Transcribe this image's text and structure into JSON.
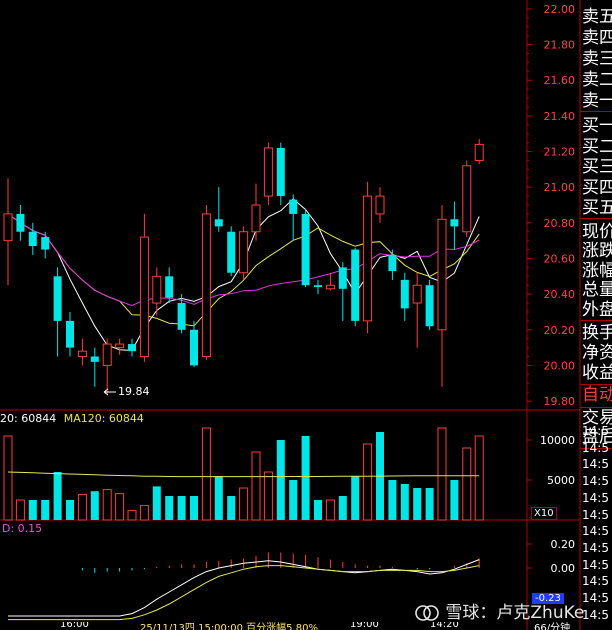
{
  "price_axis": {
    "ticks": [
      "22.00",
      "21.80",
      "21.60",
      "21.40",
      "21.20",
      "21.00",
      "20.80",
      "20.60",
      "20.40",
      "20.20",
      "20.00",
      "19.80"
    ],
    "low_marker": "19.84"
  },
  "side_labels": {
    "group1": [
      "卖五",
      "卖四",
      "卖三",
      "卖二",
      "卖一"
    ],
    "group2": [
      "买一",
      "买二",
      "买三",
      "买四",
      "买五"
    ],
    "group3": [
      "现价",
      "涨跌",
      "涨幅",
      "总量",
      "外盘"
    ],
    "group4": [
      "换手",
      "净资",
      "收益"
    ],
    "auto": "自动",
    "group5": [
      "交易",
      "盘后"
    ]
  },
  "volume_panel": {
    "legend_ma": "20: 60844",
    "legend_ma120": "MA120: 60844",
    "ticks": [
      "10000",
      "5000"
    ],
    "unit": "X10"
  },
  "macd_panel": {
    "legend": "D: 0.15",
    "ticks": [
      "0.20",
      "0.00"
    ],
    "current_value": "-0.23"
  },
  "time_column": [
    "14:5",
    "14:5",
    "14:5",
    "14:5",
    "14:5",
    "14:5",
    "14:5",
    "14:5",
    "14:5",
    "14:5",
    "14:5",
    "14:5"
  ],
  "bottom_status": [
    "16:00",
    "25/11/13四 15:00:00 百分涨幅5.80%",
    "19:00",
    "14:20",
    "66/分钟"
  ],
  "watermark": "雪球：卢克ZhuKe",
  "colors": {
    "up": "#ff3c3c",
    "down": "#00e5e5",
    "ma_white": "#ffffff",
    "ma_yellow": "#e6e64c",
    "ma_magenta": "#dd33dd",
    "grid_red": "#b00000"
  },
  "chart_data": {
    "type": "candlestick",
    "ylim": [
      19.75,
      22.05
    ],
    "candles": [
      {
        "o": 20.7,
        "c": 20.85,
        "h": 21.05,
        "l": 20.45
      },
      {
        "o": 20.85,
        "c": 20.75,
        "h": 20.9,
        "l": 20.7
      },
      {
        "o": 20.75,
        "c": 20.67,
        "h": 20.8,
        "l": 20.62
      },
      {
        "o": 20.72,
        "c": 20.65,
        "h": 20.75,
        "l": 20.6
      },
      {
        "o": 20.5,
        "c": 20.25,
        "h": 20.55,
        "l": 20.05
      },
      {
        "o": 20.25,
        "c": 20.1,
        "h": 20.3,
        "l": 20.05
      },
      {
        "o": 20.05,
        "c": 20.08,
        "h": 20.15,
        "l": 20.0
      },
      {
        "o": 20.05,
        "c": 20.02,
        "h": 20.1,
        "l": 19.88
      },
      {
        "o": 20.0,
        "c": 20.12,
        "h": 20.15,
        "l": 19.84
      },
      {
        "o": 20.1,
        "c": 20.12,
        "h": 20.15,
        "l": 20.06
      },
      {
        "o": 20.12,
        "c": 20.08,
        "h": 20.15,
        "l": 20.05
      },
      {
        "o": 20.05,
        "c": 20.72,
        "h": 20.85,
        "l": 20.02
      },
      {
        "o": 20.35,
        "c": 20.5,
        "h": 20.55,
        "l": 20.28
      },
      {
        "o": 20.5,
        "c": 20.38,
        "h": 20.55,
        "l": 20.35
      },
      {
        "o": 20.35,
        "c": 20.2,
        "h": 20.4,
        "l": 20.18
      },
      {
        "o": 20.2,
        "c": 20.0,
        "h": 20.25,
        "l": 19.99
      },
      {
        "o": 20.05,
        "c": 20.85,
        "h": 20.9,
        "l": 20.03
      },
      {
        "o": 20.82,
        "c": 20.78,
        "h": 21.0,
        "l": 20.75
      },
      {
        "o": 20.75,
        "c": 20.52,
        "h": 20.78,
        "l": 20.5
      },
      {
        "o": 20.52,
        "c": 20.75,
        "h": 20.78,
        "l": 20.48
      },
      {
        "o": 20.75,
        "c": 20.9,
        "h": 21.02,
        "l": 20.7
      },
      {
        "o": 20.95,
        "c": 21.22,
        "h": 21.25,
        "l": 20.9
      },
      {
        "o": 21.22,
        "c": 20.95,
        "h": 21.25,
        "l": 20.9
      },
      {
        "o": 20.93,
        "c": 20.85,
        "h": 20.96,
        "l": 20.7
      },
      {
        "o": 20.85,
        "c": 20.45,
        "h": 20.88,
        "l": 20.44
      },
      {
        "o": 20.45,
        "c": 20.44,
        "h": 20.48,
        "l": 20.4
      },
      {
        "o": 20.43,
        "c": 20.45,
        "h": 20.52,
        "l": 20.42
      },
      {
        "o": 20.55,
        "c": 20.43,
        "h": 20.58,
        "l": 20.25
      },
      {
        "o": 20.65,
        "c": 20.25,
        "h": 20.66,
        "l": 20.22
      },
      {
        "o": 20.25,
        "c": 20.95,
        "h": 21.03,
        "l": 20.18
      },
      {
        "o": 20.85,
        "c": 20.95,
        "h": 21.0,
        "l": 20.8
      },
      {
        "o": 20.62,
        "c": 20.53,
        "h": 20.65,
        "l": 20.48
      },
      {
        "o": 20.48,
        "c": 20.32,
        "h": 20.52,
        "l": 20.25
      },
      {
        "o": 20.35,
        "c": 20.45,
        "h": 20.52,
        "l": 20.1
      },
      {
        "o": 20.45,
        "c": 20.22,
        "h": 20.48,
        "l": 20.2
      },
      {
        "o": 20.2,
        "c": 20.82,
        "h": 20.9,
        "l": 19.88
      },
      {
        "o": 20.82,
        "c": 20.78,
        "h": 20.92,
        "l": 20.65
      },
      {
        "o": 20.75,
        "c": 21.12,
        "h": 21.15,
        "l": 20.72
      },
      {
        "o": 21.15,
        "c": 21.24,
        "h": 21.27,
        "l": 21.13
      }
    ],
    "volume": [
      {
        "v": 10500,
        "up": true
      },
      {
        "v": 2500,
        "up": true
      },
      {
        "v": 2500,
        "up": false
      },
      {
        "v": 2500,
        "up": false
      },
      {
        "v": 6000,
        "up": false
      },
      {
        "v": 2500,
        "up": false
      },
      {
        "v": 3200,
        "up": true
      },
      {
        "v": 3600,
        "up": false
      },
      {
        "v": 3800,
        "up": true
      },
      {
        "v": 3300,
        "up": true
      },
      {
        "v": 1200,
        "up": true
      },
      {
        "v": 1800,
        "up": true
      },
      {
        "v": 4200,
        "up": false
      },
      {
        "v": 3000,
        "up": false
      },
      {
        "v": 3000,
        "up": false
      },
      {
        "v": 3000,
        "up": false
      },
      {
        "v": 11500,
        "up": true
      },
      {
        "v": 5500,
        "up": false
      },
      {
        "v": 3000,
        "up": false
      },
      {
        "v": 4000,
        "up": true
      },
      {
        "v": 8500,
        "up": true
      },
      {
        "v": 6000,
        "up": true
      },
      {
        "v": 10000,
        "up": false
      },
      {
        "v": 5000,
        "up": false
      },
      {
        "v": 10500,
        "up": false
      },
      {
        "v": 2500,
        "up": false
      },
      {
        "v": 2500,
        "up": true
      },
      {
        "v": 3000,
        "up": false
      },
      {
        "v": 5500,
        "up": false
      },
      {
        "v": 9500,
        "up": true
      },
      {
        "v": 11000,
        "up": false
      },
      {
        "v": 5000,
        "up": false
      },
      {
        "v": 4500,
        "up": false
      },
      {
        "v": 4000,
        "up": false
      },
      {
        "v": 4000,
        "up": false
      },
      {
        "v": 11500,
        "up": true
      },
      {
        "v": 5000,
        "up": false
      },
      {
        "v": 9000,
        "up": true
      },
      {
        "v": 10500,
        "up": true
      }
    ],
    "volume_ylim": [
      0,
      12000
    ],
    "volume_ma": [
      6000,
      5950,
      5900,
      5850,
      5800,
      5750,
      5700,
      5650,
      5600,
      5560,
      5520,
      5480,
      5460,
      5440,
      5420,
      5420,
      5420,
      5420,
      5420,
      5420,
      5420,
      5430,
      5430,
      5440,
      5440,
      5440,
      5450,
      5460,
      5470,
      5480,
      5490,
      5500,
      5510,
      5520,
      5520,
      5520,
      5520,
      5520,
      5520
    ],
    "macd_ylim": [
      -0.45,
      0.3
    ],
    "macd_hist": [
      0,
      0,
      0,
      0,
      0,
      0,
      -0.02,
      -0.04,
      -0.03,
      -0.03,
      -0.02,
      -0.01,
      0.01,
      0.02,
      0.03,
      0.03,
      0.05,
      0.06,
      0.07,
      0.08,
      0.1,
      0.13,
      0.13,
      0.12,
      0.11,
      0.09,
      0.07,
      0.05,
      0.03,
      0.02,
      0.02,
      0.01,
      0,
      -0.01,
      -0.01,
      0,
      0.02,
      0.04,
      0.08
    ],
    "macd_dif": [
      -0.4,
      -0.4,
      -0.4,
      -0.4,
      -0.4,
      -0.4,
      -0.4,
      -0.4,
      -0.4,
      -0.4,
      -0.38,
      -0.33,
      -0.26,
      -0.2,
      -0.14,
      -0.08,
      -0.03,
      0.0,
      0.02,
      0.04,
      0.05,
      0.06,
      0.05,
      0.03,
      0.01,
      -0.01,
      -0.02,
      -0.03,
      -0.04,
      -0.03,
      -0.02,
      -0.01,
      -0.02,
      -0.03,
      -0.05,
      -0.04,
      -0.01,
      0.03,
      0.07
    ],
    "macd_dea": [
      -0.43,
      -0.43,
      -0.43,
      -0.43,
      -0.43,
      -0.43,
      -0.43,
      -0.43,
      -0.43,
      -0.43,
      -0.42,
      -0.39,
      -0.35,
      -0.3,
      -0.24,
      -0.18,
      -0.12,
      -0.07,
      -0.04,
      -0.01,
      0.01,
      0.02,
      0.02,
      0.01,
      0.0,
      -0.01,
      -0.02,
      -0.03,
      -0.03,
      -0.03,
      -0.02,
      -0.02,
      -0.02,
      -0.02,
      -0.03,
      -0.03,
      -0.02,
      0.0,
      0.02
    ]
  }
}
